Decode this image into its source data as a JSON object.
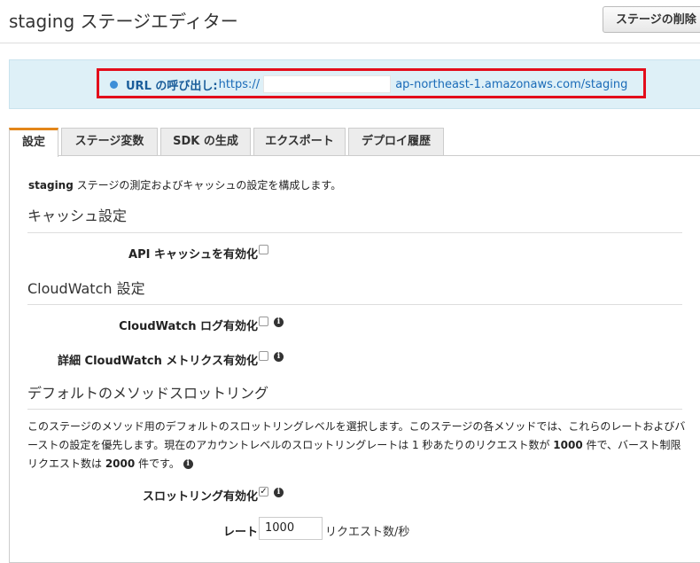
{
  "header": {
    "title": "staging ステージエディター",
    "delete_button": "ステージの削除"
  },
  "invoke_url": {
    "label": "URL の呼び出し:",
    "prefix": "https://",
    "suffix": "ap-northeast-1.amazonaws.com/staging"
  },
  "tabs": [
    {
      "label": "設定",
      "active": true
    },
    {
      "label": "ステージ変数",
      "active": false
    },
    {
      "label": "SDK の生成",
      "active": false
    },
    {
      "label": "エクスポート",
      "active": false
    },
    {
      "label": "デプロイ履歴",
      "active": false
    }
  ],
  "settings": {
    "description_bold": "staging",
    "description_rest": " ステージの測定およびキャッシュの設定を構成します。",
    "cache": {
      "title": "キャッシュ設定",
      "enable_label": "API キャッシュを有効化",
      "enabled": false
    },
    "cloudwatch": {
      "title": "CloudWatch 設定",
      "logs_label": "CloudWatch ログ有効化",
      "logs_enabled": false,
      "metrics_label": "詳細 CloudWatch メトリクス有効化",
      "metrics_enabled": false
    },
    "throttling": {
      "title": "デフォルトのメソッドスロットリング",
      "para_1": "このステージのメソッド用のデフォルトのスロットリングレベルを選択します。このステージの各メソッドでは、これらのレートおよびバーストの設定を優先します。現在のアカウントレベルのスロットリングレートは 1 秒あたりのリクエスト数が ",
      "rate_limit": "1000",
      "para_2": " 件で、バースト制限リクエスト数は ",
      "burst_limit": "2000",
      "para_3": " 件です。",
      "enable_label": "スロットリング有効化",
      "enabled": true,
      "rate_label": "レート",
      "rate_value": "1000",
      "rate_unit": "リクエスト数/秒"
    }
  }
}
